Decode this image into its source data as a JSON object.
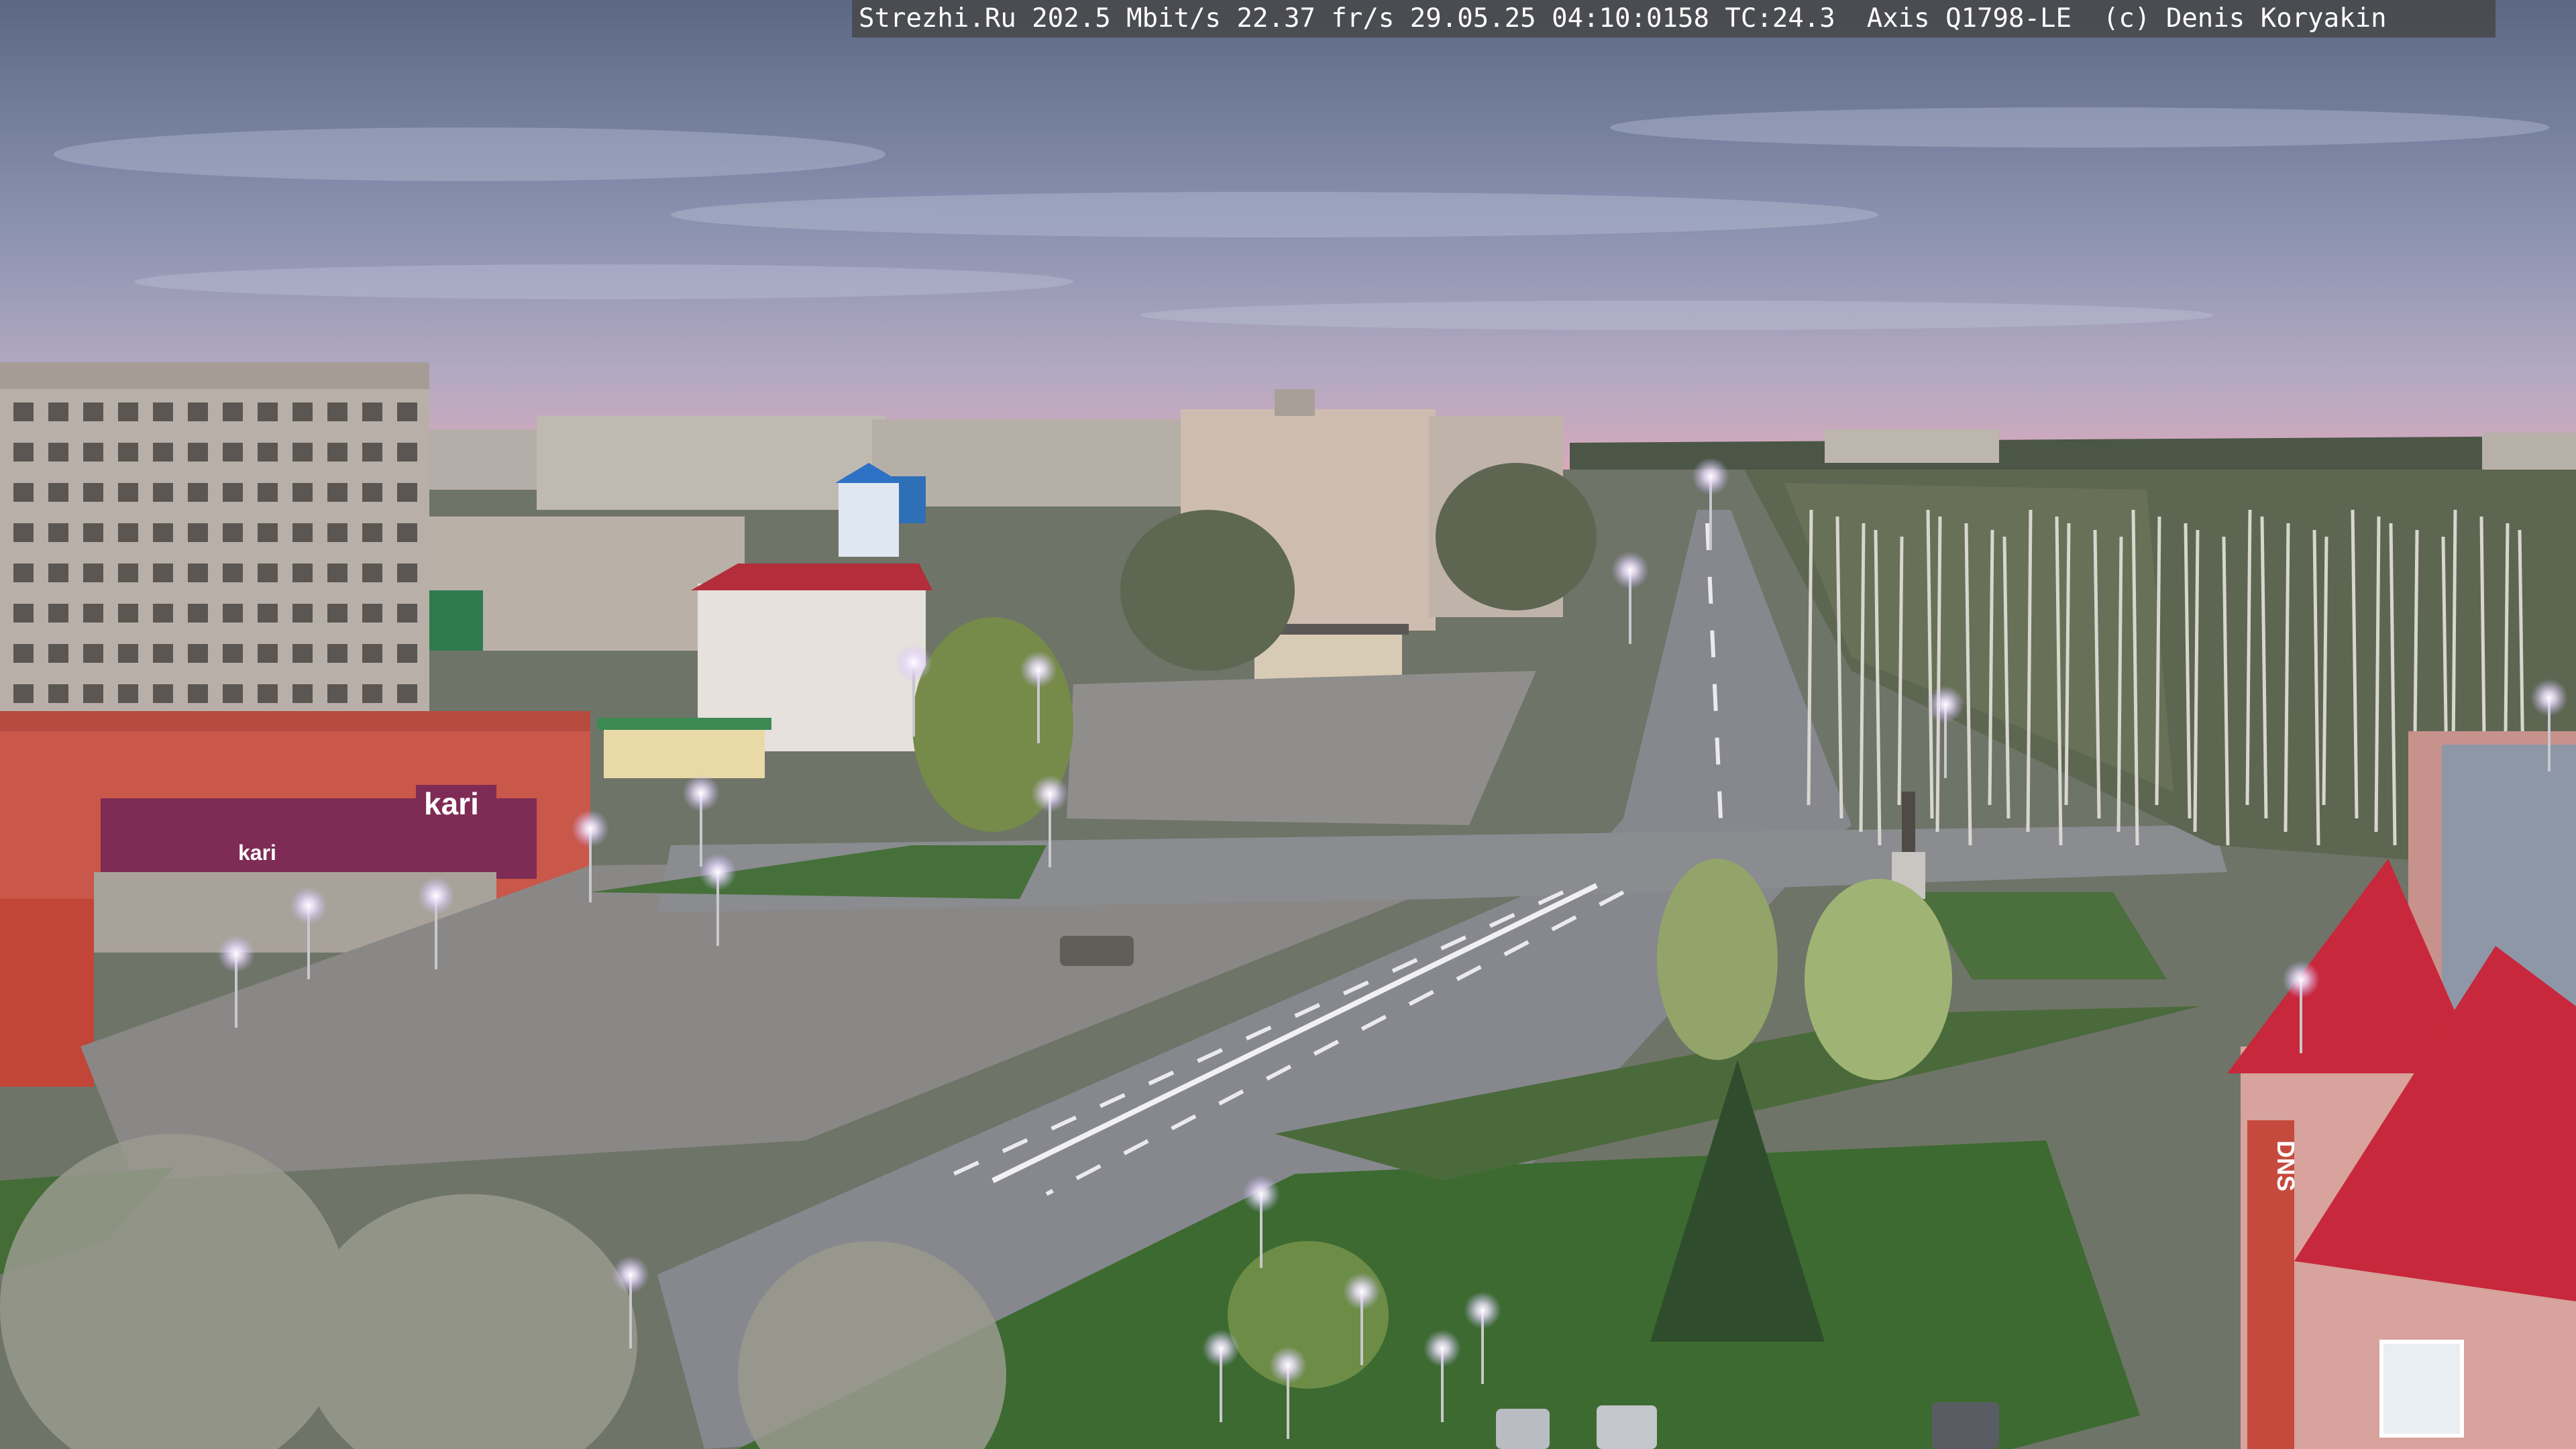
{
  "overlay": {
    "text": "Strezhi.Ru 202.5 Mbit/s 22.37 fr/s 29.05.25 04:10:0158 TC:24.3  Axis Q1798-LE  (c) Denis Koryakin"
  },
  "signs": {
    "store_kari_upper": "kari",
    "store_kari_lower": "kari",
    "store_dns": "DNS"
  },
  "palette": {
    "sky_top": "#5d6a86",
    "sky_mid": "#8f97b4",
    "sky_horizon": "#d9a9bb",
    "panel_building": "#b9b2aa",
    "road": "#85878d",
    "square": "#8b8a88",
    "grass": "#3f6b35",
    "trees_dark": "#4e5a3d",
    "red_roof": "#c8283b",
    "brick_building": "#c9564a",
    "lamp_glow": "#f3e7ff"
  }
}
